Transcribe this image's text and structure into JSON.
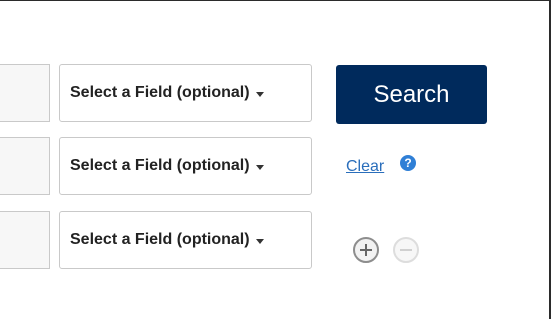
{
  "rows": [
    {
      "select_label": "Select a Field (optional)"
    },
    {
      "select_label": "Select a Field (optional)"
    },
    {
      "select_label": "Select a Field (optional)"
    }
  ],
  "actions": {
    "search_label": "Search",
    "clear_label": "Clear",
    "help_glyph": "?"
  },
  "icons": {
    "help": "question-circle-icon",
    "add": "plus-circle-icon",
    "remove": "minus-circle-icon"
  },
  "colors": {
    "search_button": "#002a5c",
    "link": "#2a6ebb",
    "help_icon": "#2f7fd6"
  }
}
